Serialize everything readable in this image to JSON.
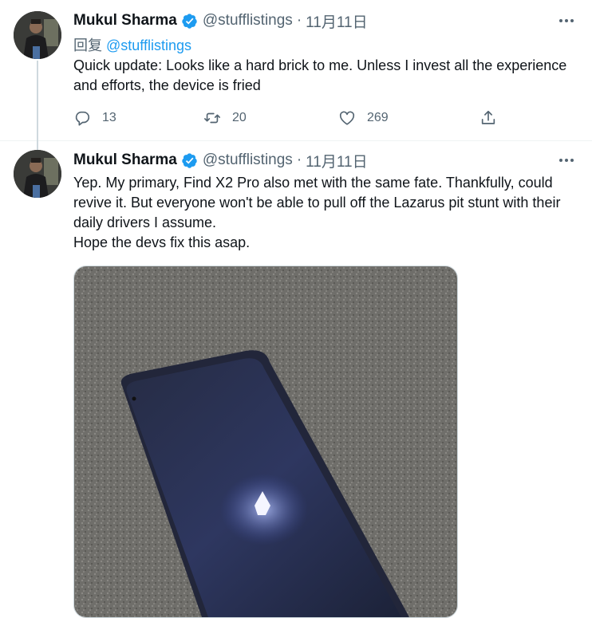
{
  "tweets": [
    {
      "display_name": "Mukul Sharma",
      "handle": "@stufflistings",
      "separator": "·",
      "date": "11月11日",
      "reply_prefix": "回复",
      "reply_to": "@stufflistings",
      "text_lines": [
        "Quick update: Looks like a hard brick to me. Unless I invest all the experience and efforts, the device is fried"
      ],
      "actions": {
        "reply_count": "13",
        "retweet_count": "20",
        "like_count": "269"
      }
    },
    {
      "display_name": "Mukul Sharma",
      "handle": "@stufflistings",
      "separator": "·",
      "date": "11月11日",
      "text_lines": [
        "Yep. My primary, Find X2 Pro also met with the same fate. Thankfully, could revive it. But everyone won't be able to pull off the Lazarus pit stunt with their daily drivers I assume.",
        "Hope the devs fix this asap."
      ]
    }
  ],
  "colors": {
    "text": "#0f1419",
    "secondary": "#536471",
    "accent": "#1d9bf0",
    "divider": "#eff3f4"
  },
  "icons": [
    "verified-badge-icon",
    "more-icon",
    "reply-icon",
    "retweet-icon",
    "like-icon",
    "share-icon"
  ]
}
